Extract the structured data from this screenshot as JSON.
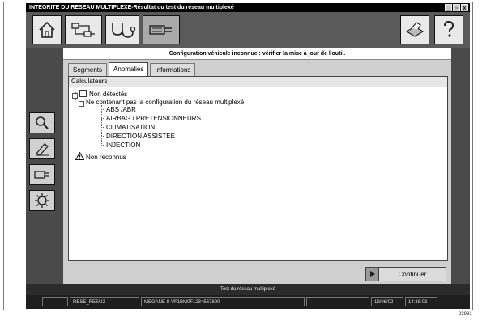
{
  "window": {
    "title": "INTEGRITE DU RESEAU MULTIPLEXE-Résultat du test du réseau multiplexé",
    "buttons": {
      "minimize": "_",
      "maximize": "▫",
      "close": "x"
    }
  },
  "message": "Configuration véhicule inconnue : vérifier la mise à jour de l'outil.",
  "tabs": [
    {
      "label": "Segments"
    },
    {
      "label": "Anomalies"
    },
    {
      "label": "Informations"
    }
  ],
  "panel": {
    "header": "Calculateurs",
    "tree": {
      "not_detected_label": "Non détectés",
      "group_label": "Ne contenant pas la configuration du réseau multiplexé",
      "items": [
        "ABS /ABR",
        "AIRBAG / PRETENSIONNEURS",
        "CLIMATISATION",
        "DIRECTION ASSISTEE",
        "INJECTION"
      ],
      "unrecognized_label": "Non reconnus"
    }
  },
  "continue_label": "Continuer",
  "status_bar": {
    "title": "Test du réseau multiplexé",
    "fields": [
      "----",
      "RESE_RESU2",
      "MEGANE II-VF1BM0F1234567890",
      "",
      "19/06/02",
      "14:38:03"
    ]
  },
  "figure_number": "23981"
}
